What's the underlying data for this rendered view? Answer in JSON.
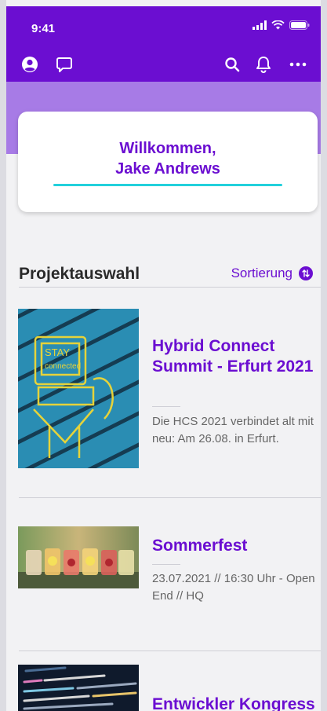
{
  "status": {
    "time": "9:41"
  },
  "toolbar": {
    "profile_icon": "user-circle-icon",
    "chat_icon": "chat-bubble-icon",
    "search_icon": "search-icon",
    "bell_icon": "bell-icon",
    "more_icon": "more-icon"
  },
  "welcome": {
    "line1": "Willkommen,",
    "line2": "Jake Andrews"
  },
  "projects_section": {
    "title": "Projektauswahl",
    "sort_label": "Sortierung"
  },
  "projects": [
    {
      "title": "Hybrid Connect Summit - Erfurt 2021",
      "description": "Die HCS 2021 verbindet alt mit neu: Am 26.08. in Erfurt.",
      "image": "stay-connected-street-art"
    },
    {
      "title": "Sommerfest",
      "description": "23.07.2021 // 16:30 Uhr - Open End // HQ",
      "image": "drinks-in-jars"
    },
    {
      "title": "Entwickler Kongress",
      "description": "",
      "image": "code-on-screen"
    }
  ],
  "colors": {
    "primary": "#6b0ed1",
    "lavender": "#a77be6",
    "accent": "#22d0dc"
  }
}
